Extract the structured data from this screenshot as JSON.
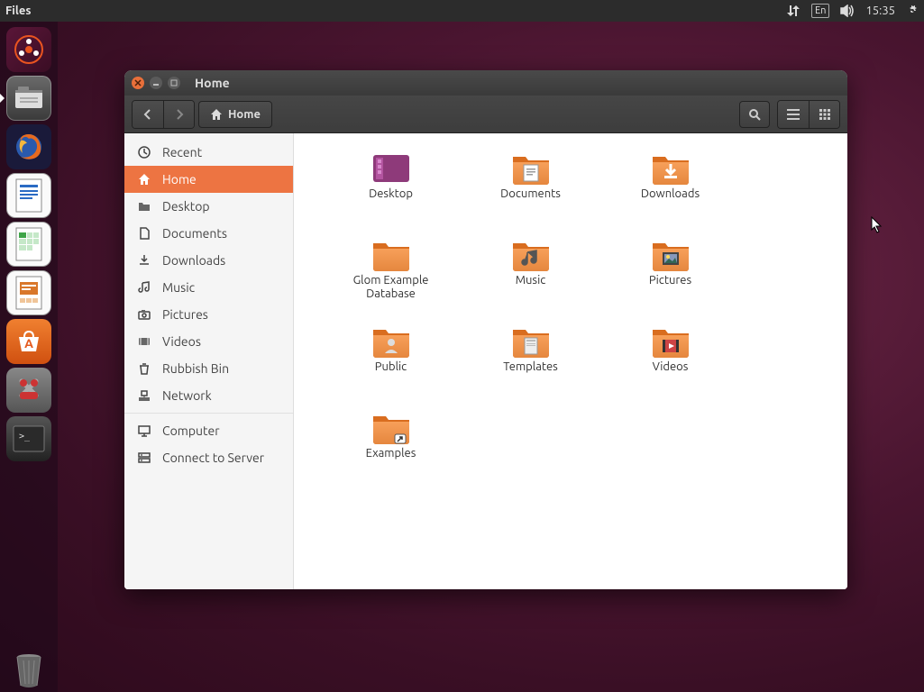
{
  "menubar": {
    "title": "Files",
    "language": "En",
    "time": "15:35"
  },
  "window": {
    "title": "Home",
    "location": "Home"
  },
  "sidebar": [
    {
      "label": "Recent",
      "icon": "clock"
    },
    {
      "label": "Home",
      "icon": "home",
      "active": true
    },
    {
      "label": "Desktop",
      "icon": "folder"
    },
    {
      "label": "Documents",
      "icon": "document"
    },
    {
      "label": "Downloads",
      "icon": "download"
    },
    {
      "label": "Music",
      "icon": "music"
    },
    {
      "label": "Pictures",
      "icon": "camera"
    },
    {
      "label": "Videos",
      "icon": "video"
    },
    {
      "label": "Rubbish Bin",
      "icon": "trash"
    },
    {
      "label": "Network",
      "icon": "network"
    }
  ],
  "sidebar2": [
    {
      "label": "Computer",
      "icon": "computer"
    },
    {
      "label": "Connect to Server",
      "icon": "server"
    }
  ],
  "folders": [
    {
      "label": "Desktop",
      "type": "desktop"
    },
    {
      "label": "Documents",
      "type": "document"
    },
    {
      "label": "Downloads",
      "type": "download"
    },
    {
      "label": "Glom Example\nDatabase",
      "type": "plain"
    },
    {
      "label": "Music",
      "type": "music"
    },
    {
      "label": "Pictures",
      "type": "picture"
    },
    {
      "label": "Public",
      "type": "public"
    },
    {
      "label": "Templates",
      "type": "template"
    },
    {
      "label": "Videos",
      "type": "video"
    },
    {
      "label": "Examples",
      "type": "link"
    }
  ]
}
